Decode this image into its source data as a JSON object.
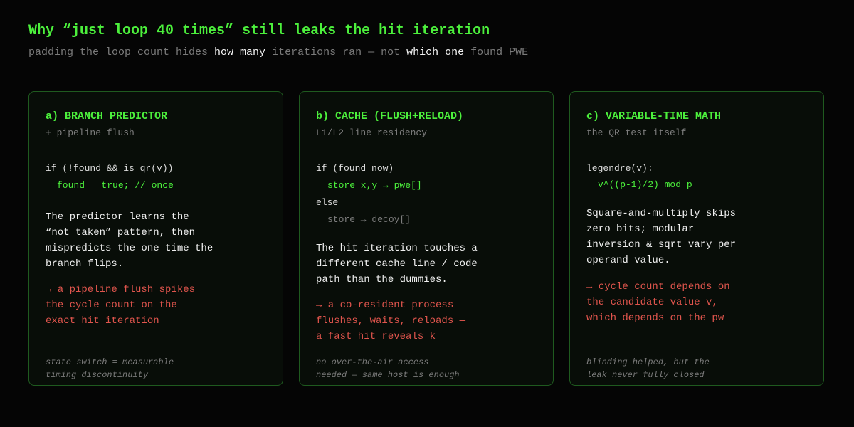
{
  "header": {
    "title": "Why “just loop 40 times” still leaks the hit iteration",
    "subtitle_parts": [
      "padding the loop count hides ",
      "how many",
      " iterations ran — not ",
      "which one",
      " found PWE"
    ]
  },
  "cards": [
    {
      "title": "a) BRANCH PREDICTOR",
      "subtitle": "+ pipeline flush",
      "code": [
        "if (!found && is_qr(v))",
        "found = true; // once"
      ],
      "body": "The predictor learns the\n“not taken” pattern, then\nmispredicts the one time the\nbranch flips.",
      "consequence": "→ a pipeline flush spikes\nthe cycle count on the\nexact hit iteration",
      "footnote": "state switch = measurable\ntiming discontinuity"
    },
    {
      "title": "b) CACHE (FLUSH+RELOAD)",
      "subtitle": "L1/L2 line residency",
      "code": [
        "if (found_now)",
        "store x,y → pwe[]",
        "else",
        "store → decoy[]"
      ],
      "body": "The hit iteration touches a\ndifferent cache line / code\npath than the dummies.",
      "consequence": "→ a co-resident process\nflushes, waits, reloads —\na fast hit reveals k",
      "footnote": "no over-the-air access\nneeded — same host is enough"
    },
    {
      "title": "c) VARIABLE-TIME MATH",
      "subtitle": "the QR test itself",
      "code": [
        "legendre(v):",
        "v^((p-1)/2) mod p"
      ],
      "body": "Square-and-multiply skips\nzero bits; modular\ninversion & sqrt vary per\noperand value.",
      "consequence": "→ cycle count depends on\nthe candidate value v,\nwhich depends on the pw",
      "footnote": "blinding helped, but the\nleak never fully closed"
    }
  ],
  "colors": {
    "accent_green": "#4cf03c",
    "warning_red": "#e0554d",
    "card_border": "#1f5a1f",
    "background": "#050505"
  }
}
